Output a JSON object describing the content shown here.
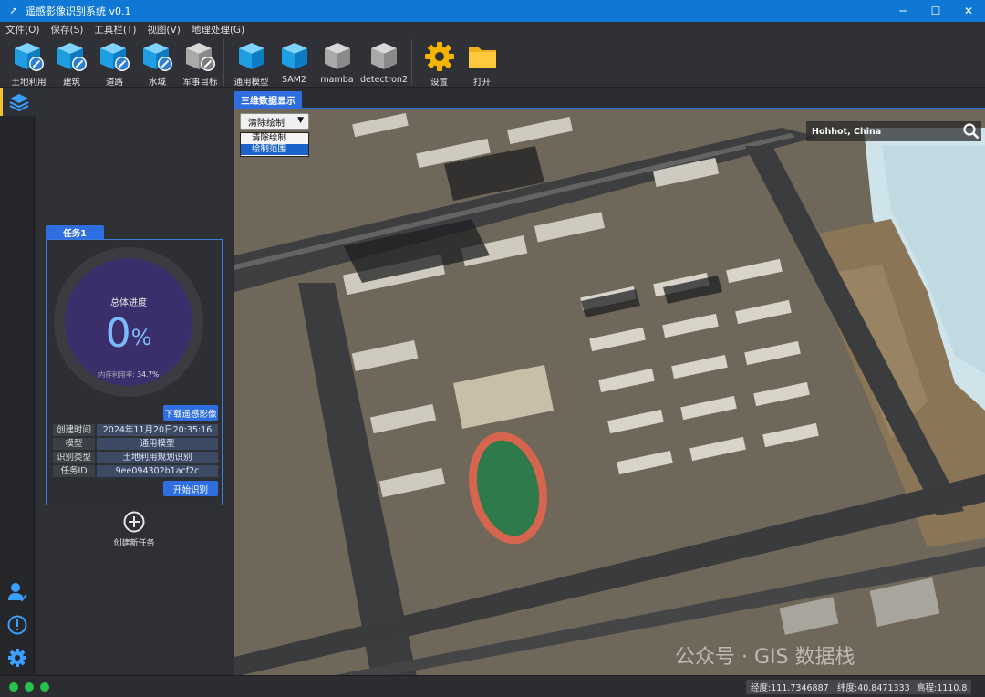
{
  "window": {
    "title": "遥感影像识别系统 v0.1",
    "minimize": "─",
    "maximize": "☐",
    "close": "✕"
  },
  "menu": [
    "文件(O)",
    "保存(S)",
    "工具栏(T)",
    "视图(V)",
    "地理处理(G)"
  ],
  "toolbar": {
    "group1": [
      {
        "label": "土地利用",
        "icon": "blue-cube-edit-icon"
      },
      {
        "label": "建筑",
        "icon": "blue-cube-edit-icon"
      },
      {
        "label": "道路",
        "icon": "blue-cube-edit-icon"
      },
      {
        "label": "水域",
        "icon": "blue-cube-edit-icon"
      },
      {
        "label": "军事目标",
        "icon": "gray-cube-edit-icon"
      }
    ],
    "group2": [
      {
        "label": "通用模型",
        "icon": "blue-cube-icon"
      },
      {
        "label": "SAM2",
        "icon": "blue-cube-icon"
      },
      {
        "label": "mamba",
        "icon": "gray-cube-icon"
      },
      {
        "label": "detectron2",
        "icon": "gray-cube-icon"
      }
    ],
    "group3": [
      {
        "label": "设置",
        "icon": "gear-icon"
      },
      {
        "label": "打开",
        "icon": "folder-icon"
      }
    ]
  },
  "task": {
    "tab": "任务1",
    "progress_title": "总体进度",
    "progress_value": "0",
    "progress_unit": "%",
    "progress_fraction": 0,
    "memory_label": "内存利用率:",
    "memory_value": "34.7%",
    "download_button": "下载遥感影像",
    "start_button": "开始识别",
    "info": [
      {
        "key": "创建时间",
        "value": "2024年11月20日20:35:16"
      },
      {
        "key": "模型",
        "value": "通用模型"
      },
      {
        "key": "识别类型",
        "value": "土地利用规划识别"
      },
      {
        "key": "任务ID",
        "value": "9ee094302b1acf2c"
      }
    ]
  },
  "new_task": {
    "label": "创建新任务"
  },
  "map": {
    "tab": "三维数据显示",
    "draw_select": {
      "value": "清除绘制",
      "options": [
        "清除绘制",
        "绘制范围"
      ],
      "highlighted": "绘制范围"
    },
    "search": {
      "value": "Hohhot, China"
    }
  },
  "watermark": "公众号 · GIS 数据栈",
  "status": {
    "lon": "经度:111.7346887",
    "lat": "纬度:40.8471333",
    "alt": "高程:1110.8"
  },
  "colors": {
    "accent": "#2f6ee0",
    "titlebar": "#0f78d4",
    "status_dot": "#27c24c"
  }
}
